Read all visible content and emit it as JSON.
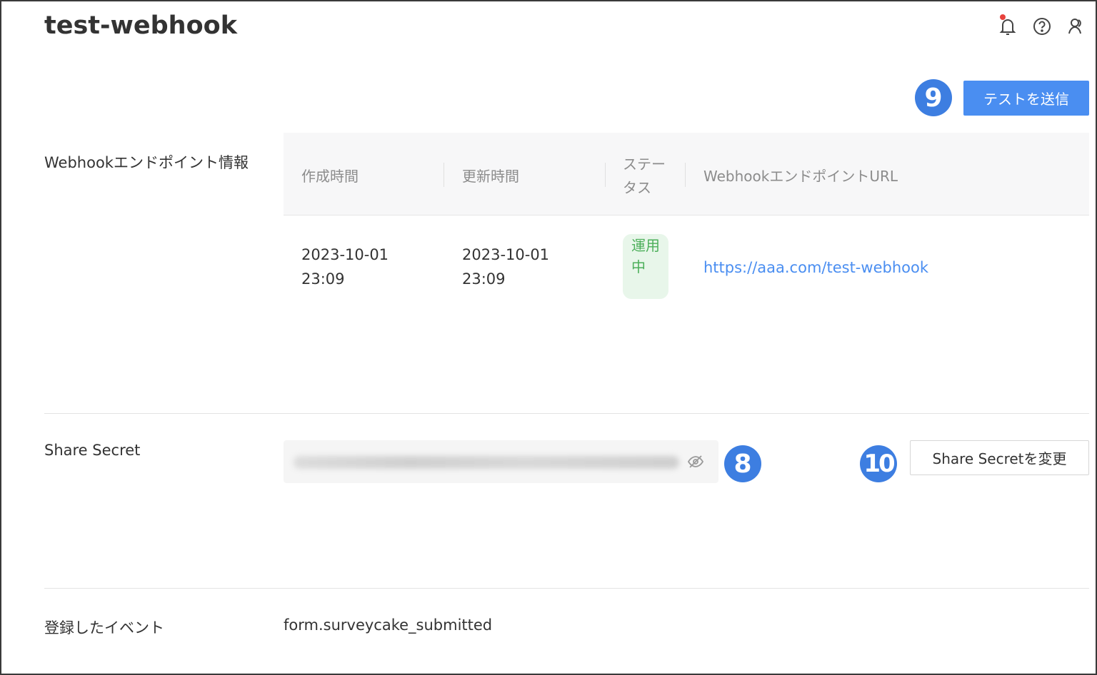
{
  "header": {
    "title": "test-webhook",
    "icons": [
      "bell-icon",
      "help-icon",
      "user-icon"
    ]
  },
  "actions": {
    "send_test_label": "テストを送信",
    "change_secret_label": "Share Secretを変更"
  },
  "step_badges": {
    "send_test": "9",
    "secret_field": "8",
    "change_secret": "10"
  },
  "endpoint": {
    "section_label": "Webhookエンドポイント情報",
    "columns": {
      "created": "作成時間",
      "updated": "更新時間",
      "status": "ステータス",
      "url": "WebhookエンドポイントURL"
    },
    "row": {
      "created": "2023-10-01 23:09",
      "updated": "2023-10-01 23:09",
      "status": "運用中",
      "url": "https://aaa.com/test-webhook"
    }
  },
  "secret": {
    "section_label": "Share Secret",
    "value_masked": true
  },
  "events": {
    "section_label": "登録したイベント",
    "value": "form.surveycake_submitted"
  },
  "colors": {
    "primary": "#4a8ef1",
    "badge": "#3d7ee1",
    "status_bg": "#e8f6ea",
    "status_text": "#4caf5a",
    "notification": "#e8423c"
  }
}
